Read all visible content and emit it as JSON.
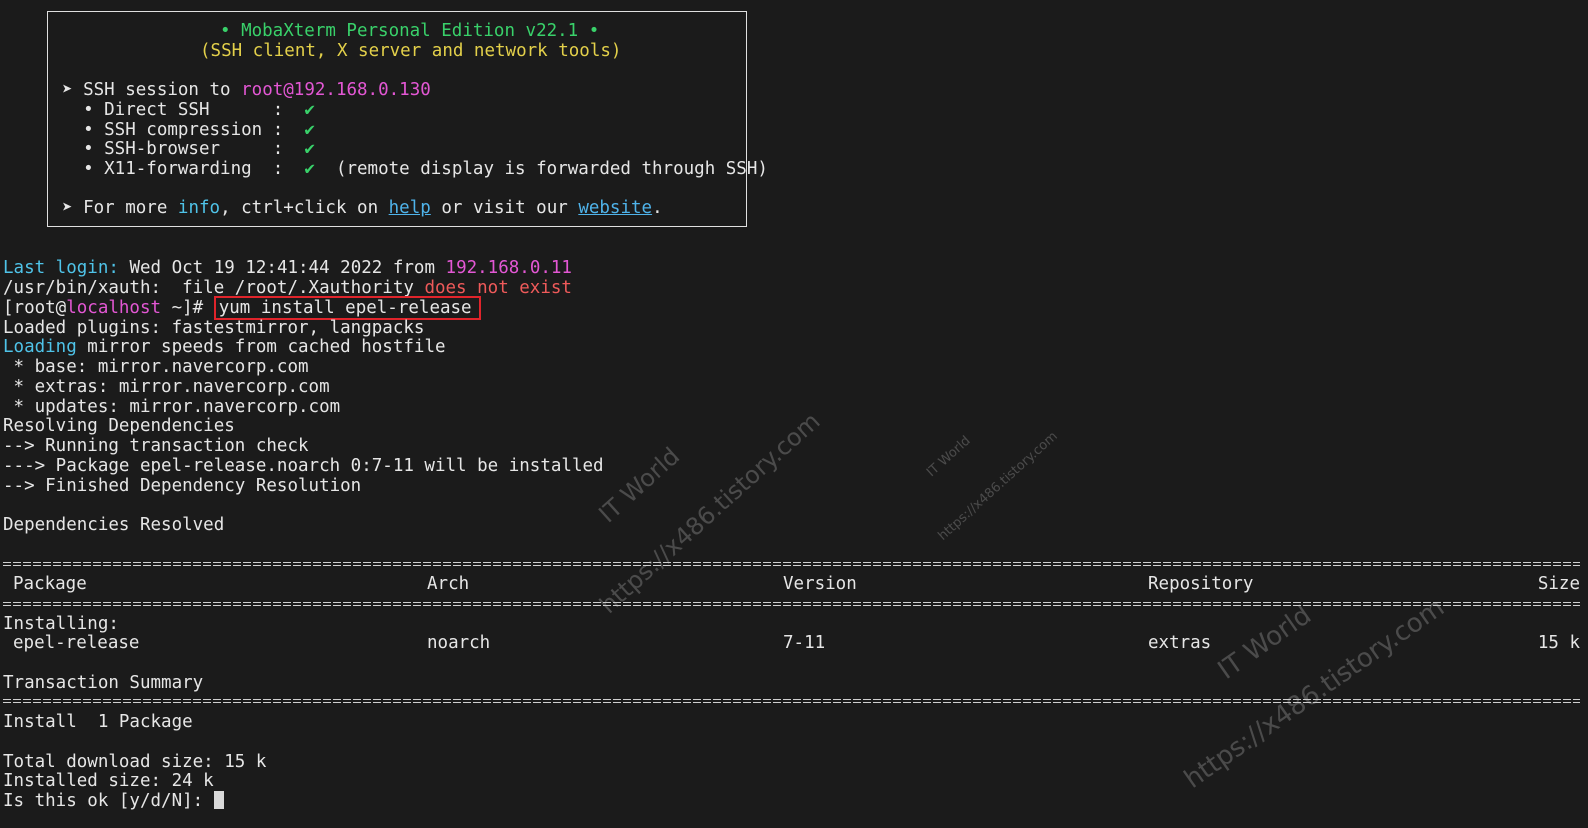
{
  "banner": {
    "title": "• MobaXterm Personal Edition v22.1 •",
    "subtitle": "(SSH client, X server and network tools)",
    "session_prefix": "➤ SSH session to ",
    "session_target": "root@192.168.0.130",
    "features": [
      {
        "label": "  • Direct SSH      :  ",
        "check": "✔",
        "note": ""
      },
      {
        "label": "  • SSH compression :  ",
        "check": "✔",
        "note": ""
      },
      {
        "label": "  • SSH-browser     :  ",
        "check": "✔",
        "note": ""
      },
      {
        "label": "  • X11-forwarding  :  ",
        "check": "✔",
        "note": "  (remote display is forwarded through SSH)"
      }
    ],
    "more_prefix": "➤ For more ",
    "more_info": "info",
    "more_mid": ", ctrl+click on ",
    "more_help": "help",
    "more_mid2": " or visit our ",
    "more_website": "website",
    "more_end": "."
  },
  "terminal": {
    "last_login_label": "Last login:",
    "last_login_text": " Wed Oct 19 12:41:44 2022 from ",
    "last_login_ip": "192.168.0.11",
    "xauth_text": "/usr/bin/xauth:  file /root/.Xauthority ",
    "xauth_warn": "does not exist",
    "prompt_open": "[root@",
    "prompt_host": "localhost",
    "prompt_close": " ~]# ",
    "command": "yum install epel-release",
    "loaded_plugins": "Loaded plugins: fastestmirror, langpacks",
    "loading_word": "Loading",
    "loading_rest": " mirror speeds from cached hostfile",
    "mirrors": [
      " * base: mirror.navercorp.com",
      " * extras: mirror.navercorp.com",
      " * updates: mirror.navercorp.com"
    ],
    "resolving": "Resolving Dependencies",
    "running_check": "--> Running transaction check",
    "package_line": "---> Package epel-release.noarch 0:7-11 will be installed",
    "finished": "--> Finished Dependency Resolution",
    "deps_resolved": "Dependencies Resolved",
    "table": {
      "headers": [
        "Package",
        "Arch",
        "Version",
        "Repository",
        "Size"
      ],
      "section": "Installing:",
      "rows": [
        {
          "package": "epel-release",
          "arch": "noarch",
          "version": "7-11",
          "repository": "extras",
          "size": "15 k"
        }
      ]
    },
    "transaction_summary": "Transaction Summary",
    "install_summary": "Install  1 Package",
    "total_download": "Total download size: 15 k",
    "installed_size": "Installed size: 24 k",
    "confirm_prompt": "Is this ok [y/d/N]: "
  },
  "watermarks": [
    {
      "line1": "IT World",
      "line2": "https://x486.tistory.com"
    },
    {
      "line1": "IT World",
      "line2": "https://x486.tistory.com"
    },
    {
      "line1": "IT World",
      "line2": "https://x486.tistory.com"
    }
  ],
  "colors": {
    "background": "#1b1b1b",
    "green": "#39d16a",
    "yellow": "#e3d04a",
    "magenta": "#e357d4",
    "cyan": "#4fc3e8",
    "red": "#ef5a5a",
    "highlight_box": "#e0242b"
  }
}
